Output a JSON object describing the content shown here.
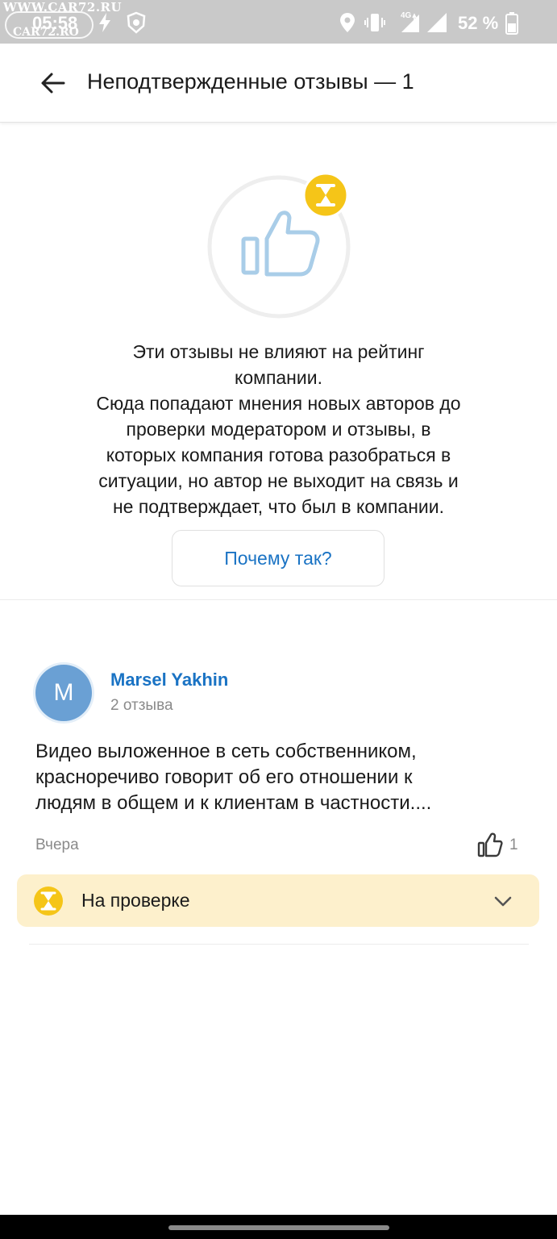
{
  "status_bar": {
    "watermark_top": "WWW.CAR72.RU",
    "time": "05:58",
    "watermark_bottom": "CAR72.RO",
    "battery_percent": "52 %",
    "network_label": "4G",
    "icons": [
      "lightning-icon",
      "lion-logo-icon",
      "location-icon",
      "vibrate-icon",
      "mobile-signal-icon",
      "wifi-signal-icon",
      "battery-icon"
    ]
  },
  "header": {
    "back_icon": "arrow-left-icon",
    "title": "Неподтвержденные отзывы — 1"
  },
  "info": {
    "illustration_icon": "thumbs-up-icon",
    "badge_icon": "hourglass-icon",
    "line1": "Эти отзывы не влияют на рейтинг",
    "line2": "компании.",
    "line3": "Сюда попадают мнения новых авторов до",
    "line4": "проверки модератором и отзывы, в",
    "line5": "которых компания готова разобраться в",
    "line6": "ситуации, но автор не выходит на связь и",
    "line7": "не подтверждает, что был в компании.",
    "why_button": "Почему так?"
  },
  "review": {
    "avatar_letter": "M",
    "author": "Marsel Yakhin",
    "author_reviews": "2 отзыва",
    "text_line1": "Видео выложенное в сеть собственником,",
    "text_line2": "красноречиво говорит об его отношении к",
    "text_line3": "людям в общем и к клиентам в частности....",
    "date": "Вчера",
    "like_icon": "thumbs-up-icon",
    "likes": "1",
    "status_icon": "hourglass-icon",
    "status_label": "На проверке",
    "expand_icon": "chevron-down-icon"
  },
  "colors": {
    "accent_link": "#1a73c4",
    "status_panel_bg": "#fdf0cc",
    "badge_yellow": "#f5c518",
    "avatar_bg": "#6aa0d4"
  }
}
